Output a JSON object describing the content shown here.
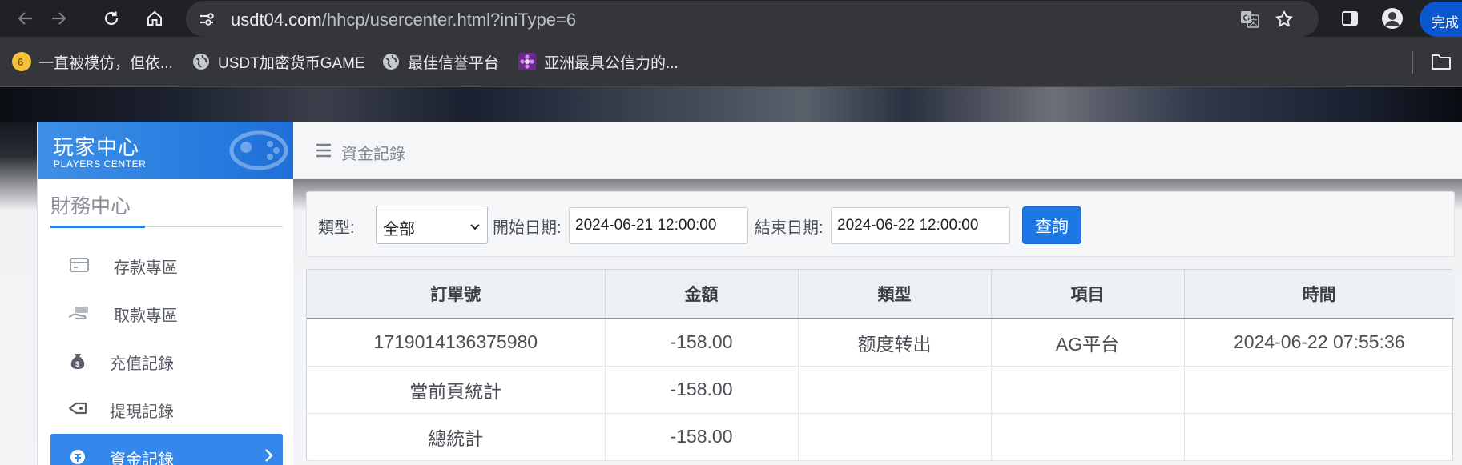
{
  "browser": {
    "url_host": "usdt04.com",
    "url_path": "/hhcp/usercenter.html?iniType=6",
    "finish_label": "完成",
    "bookmarks": [
      {
        "label": "一直被模仿，但依...",
        "icon": "coin-icon"
      },
      {
        "label": "USDT加密货币GAME",
        "icon": "globe-icon"
      },
      {
        "label": "最佳信誉平台",
        "icon": "globe-icon"
      },
      {
        "label": "亚洲最具公信力的...",
        "icon": "flower-icon"
      }
    ]
  },
  "sidebar": {
    "brand_cn": "玩家中心",
    "brand_en": "PLAYERS CENTER",
    "section_title": "財務中心",
    "items": [
      {
        "label": "存款專區",
        "icon": "card-icon",
        "active": false
      },
      {
        "label": "取款專區",
        "icon": "hand-money-icon",
        "active": false
      },
      {
        "label": "充值記錄",
        "icon": "money-bag-icon",
        "active": false
      },
      {
        "label": "提現記錄",
        "icon": "tag-icon",
        "active": false
      },
      {
        "label": "資金記錄",
        "icon": "fund-icon",
        "active": true
      }
    ]
  },
  "main": {
    "breadcrumb": "資金記錄",
    "filter": {
      "type_label": "類型:",
      "type_value": "全部",
      "start_label": "開始日期:",
      "start_value": "2024-06-21 12:00:00",
      "end_label": "結束日期:",
      "end_value": "2024-06-22 12:00:00",
      "query_label": "查詢"
    },
    "table": {
      "headers": [
        "訂單號",
        "金額",
        "類型",
        "項目",
        "時間"
      ],
      "rows": [
        [
          "1719014136375980",
          "-158.00",
          "额度转出",
          "AG平台",
          "2024-06-22 07:55:36"
        ],
        [
          "當前頁統計",
          "-158.00",
          "",
          "",
          ""
        ],
        [
          "總統計",
          "-158.00",
          "",
          "",
          ""
        ]
      ]
    }
  },
  "colors": {
    "accent": "#2d7fe4",
    "brand_blue": "#3487eb",
    "query_button": "#1d77e5",
    "chrome_dark": "#202124"
  }
}
